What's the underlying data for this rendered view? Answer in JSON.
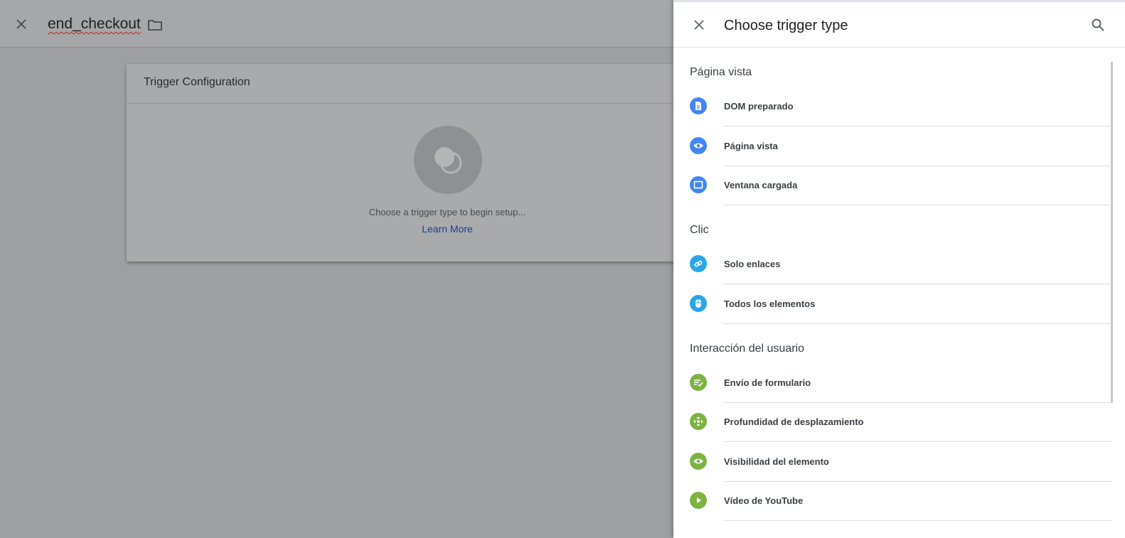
{
  "editor": {
    "title": "end_checkout",
    "card": {
      "title": "Trigger Configuration",
      "hint": "Choose a trigger type to begin setup...",
      "learn_more": "Learn More"
    }
  },
  "panel": {
    "title": "Choose trigger type",
    "sections": [
      {
        "title": "Página vista",
        "items": [
          {
            "label": "DOM preparado",
            "icon": "document-icon",
            "color": "#4285f4"
          },
          {
            "label": "Página vista",
            "icon": "eye-icon",
            "color": "#4285f4"
          },
          {
            "label": "Ventana cargada",
            "icon": "window-icon",
            "color": "#4285f4"
          }
        ]
      },
      {
        "title": "Clic",
        "items": [
          {
            "label": "Solo enlaces",
            "icon": "link-icon",
            "color": "#2aa6e8"
          },
          {
            "label": "Todos los elementos",
            "icon": "mouse-icon",
            "color": "#2aa6e8"
          }
        ]
      },
      {
        "title": "Interacción del usuario",
        "items": [
          {
            "label": "Envío de formulario",
            "icon": "form-submit-icon",
            "color": "#7cb342"
          },
          {
            "label": "Profundidad de desplazamiento",
            "icon": "scroll-move-icon",
            "color": "#7cb342"
          },
          {
            "label": "Visibilidad del elemento",
            "icon": "eye-icon",
            "color": "#7cb342"
          },
          {
            "label": "Vídeo de YouTube",
            "icon": "play-icon",
            "color": "#7cb342"
          }
        ]
      }
    ]
  }
}
